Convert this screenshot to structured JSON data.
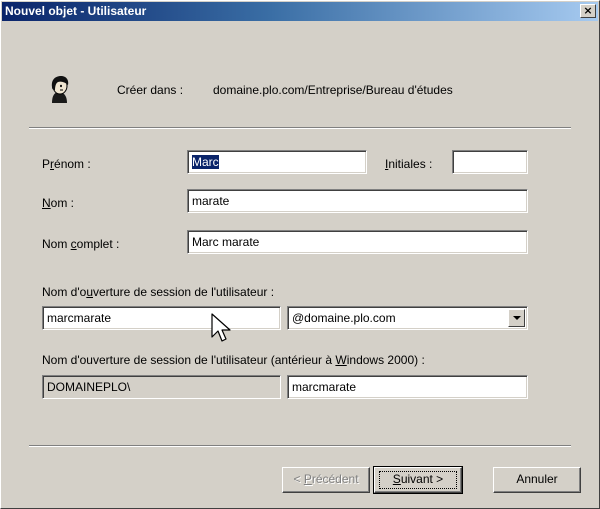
{
  "window": {
    "title": "Nouvel objet - Utilisateur",
    "close_glyph": "×"
  },
  "header": {
    "icon": "user-icon",
    "create_in_label": "Créer dans :",
    "create_in_path": "domaine.plo.com/Entreprise/Bureau d'études"
  },
  "form": {
    "prenom_label_pre": "P",
    "prenom_label_key": "r",
    "prenom_label_post": "énom :",
    "prenom_value": "Marc",
    "initiales_label_key": "I",
    "initiales_label_post": "nitiales :",
    "initiales_value": "",
    "nom_label_key": "N",
    "nom_label_post": "om :",
    "nom_value": "marate",
    "nom_complet_label_pre": "Nom ",
    "nom_complet_label_key": "c",
    "nom_complet_label_post": "omplet :",
    "nom_complet_value": "Marc marate",
    "logon_label_pre": "Nom d'o",
    "logon_label_key": "u",
    "logon_label_post": "verture de session de l'utilisateur :",
    "logon_value": "marcmarate",
    "domain_suffix_selected": "@domaine.plo.com",
    "logon_pre2000_label_pre": "Nom d'ouverture de session de l'utilisateur (antérieur à ",
    "logon_pre2000_label_key": "W",
    "logon_pre2000_label_post": "indows 2000) :",
    "netbios_domain": "DOMAINEPLO\\",
    "logon_pre2000_value": "marcmarate"
  },
  "buttons": {
    "back_pre": "< ",
    "back_key": "P",
    "back_post": "récédent",
    "next_key": "S",
    "next_post": "uivant >",
    "cancel_label": "Annuler"
  },
  "colors": {
    "title_gradient_start": "#0a246a",
    "title_gradient_end": "#a6caf0",
    "dialog_face": "#d4d0c8",
    "selection": "#0a246a"
  }
}
